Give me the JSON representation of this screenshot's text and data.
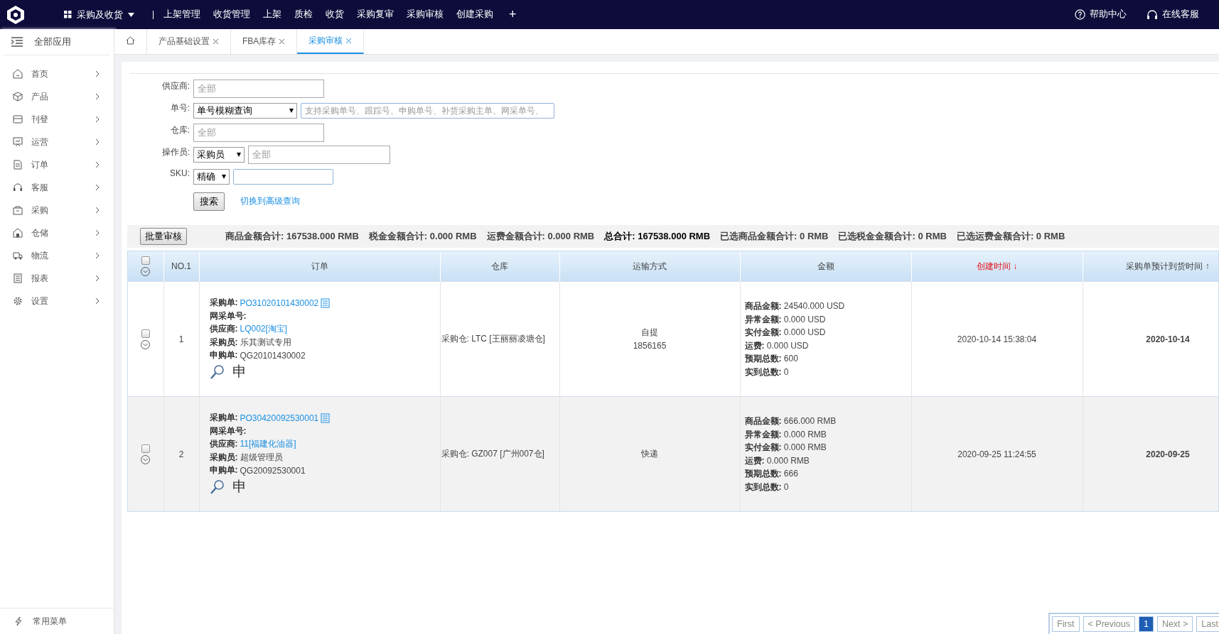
{
  "topbar": {
    "app_menu": "采购及收货",
    "nav": [
      "上架管理",
      "收货管理",
      "上架",
      "质检",
      "收货",
      "采购复审",
      "采购审核",
      "创建采购"
    ],
    "add": "+",
    "help": "帮助中心",
    "service": "在线客服"
  },
  "sidebar": {
    "header": "全部应用",
    "items": [
      {
        "label": "首页"
      },
      {
        "label": "产品"
      },
      {
        "label": "刊登"
      },
      {
        "label": "运营"
      },
      {
        "label": "订单"
      },
      {
        "label": "客服"
      },
      {
        "label": "采购"
      },
      {
        "label": "仓储"
      },
      {
        "label": "物流"
      },
      {
        "label": "报表"
      },
      {
        "label": "设置"
      }
    ],
    "footer": "常用菜单"
  },
  "tabs": [
    {
      "label": "产品基础设置",
      "selected": false
    },
    {
      "label": "FBA库存",
      "selected": false
    },
    {
      "label": "采购审核",
      "selected": true
    }
  ],
  "form": {
    "supplier_label": "供应商:",
    "supplier_placeholder": "全部",
    "order_label": "单号:",
    "order_mode": "单号模糊查询",
    "order_placeholder": "支持采购单号、跟踪号、申购单号、补货采购主单、网采单号、",
    "warehouse_label": "仓库:",
    "warehouse_placeholder": "全部",
    "operator_label": "操作员:",
    "operator_role": "采购员",
    "operator_placeholder": "全部",
    "sku_label": "SKU:",
    "sku_mode": "精确",
    "search_button": "搜索",
    "advanced_link": "切换到高级查询"
  },
  "summary": {
    "batch_button": "批量审核",
    "totals": [
      {
        "label": "商品金额合计:",
        "value": "167538.000 RMB",
        "strong": false
      },
      {
        "label": "税金金额合计:",
        "value": "0.000 RMB",
        "strong": false
      },
      {
        "label": "运费金额合计:",
        "value": "0.000 RMB",
        "strong": false
      },
      {
        "label": "总合计:",
        "value": "167538.000 RMB",
        "strong": true
      },
      {
        "label": "已选商品金额合计:",
        "value": "0 RMB",
        "strong": false
      },
      {
        "label": "已选税金金额合计:",
        "value": "0 RMB",
        "strong": false
      },
      {
        "label": "已选运费金额合计:",
        "value": "0 RMB",
        "strong": false
      }
    ]
  },
  "table": {
    "all_checked": false,
    "columns": [
      {
        "label": "NO.1",
        "sorted": false
      },
      {
        "label": "订单",
        "sorted": false
      },
      {
        "label": "仓库",
        "sorted": false
      },
      {
        "label": "运输方式",
        "sorted": false
      },
      {
        "label": "金额",
        "sorted": false
      },
      {
        "label": "创建时间 ↓",
        "sorted": true
      },
      {
        "label": "采购单预计到货时间 ↑",
        "sorted": false
      }
    ],
    "rows": [
      {
        "checked": false,
        "highlighted": false,
        "no": "1",
        "po_label": "采购单:",
        "po": "PO31020101430002",
        "online_label": "网采单号:",
        "supplier_label": "供应商:",
        "supplier": "LQ002[淘宝]",
        "buyer_label": "采购员:",
        "buyer": "乐其测试专用",
        "request_label": "申购单:",
        "request": "QG20101430002",
        "apply_mark": "申",
        "warehouse": "采购仓: LTC [王丽丽凌塘仓]",
        "shipping": [
          "自提",
          "1856165"
        ],
        "amounts": [
          {
            "label": "商品金额:",
            "value": "24540.000  USD"
          },
          {
            "label": "异常金额:",
            "value": "0.000  USD"
          },
          {
            "label": "实付金额:",
            "value": "0.000  USD"
          },
          {
            "label": "运费:",
            "value": "0.000  USD"
          },
          {
            "label": "预期总数:",
            "value": "600"
          },
          {
            "label": "实到总数:",
            "value": "0"
          }
        ],
        "created": "2020-10-14 15:38:04",
        "eta": "2020-10-14"
      },
      {
        "checked": false,
        "highlighted": true,
        "no": "2",
        "po_label": "采购单:",
        "po": "PO30420092530001",
        "online_label": "网采单号:",
        "supplier_label": "供应商:",
        "supplier": "11[福建化油器]",
        "buyer_label": "采购员:",
        "buyer": "超级管理员",
        "request_label": "申购单:",
        "request": "QG20092530001",
        "apply_mark": "申",
        "warehouse": "采购仓: GZ007 [广州007仓]",
        "shipping": [
          "快递"
        ],
        "amounts": [
          {
            "label": "商品金额:",
            "value": "666.000  RMB"
          },
          {
            "label": "异常金额:",
            "value": "0.000  RMB"
          },
          {
            "label": "实付金额:",
            "value": "0.000  RMB"
          },
          {
            "label": "运费:",
            "value": "0.000  RMB"
          },
          {
            "label": "预期总数:",
            "value": "666"
          },
          {
            "label": "实到总数:",
            "value": "0"
          }
        ],
        "created": "2020-09-25 11:24:55",
        "eta": "2020-09-25"
      }
    ]
  },
  "pagination": [
    {
      "label": "First",
      "selected": false
    },
    {
      "label": "< Previous",
      "selected": false
    },
    {
      "label": "1",
      "selected": true
    },
    {
      "label": "Next >",
      "selected": false
    },
    {
      "label": "Last",
      "selected": false
    }
  ]
}
